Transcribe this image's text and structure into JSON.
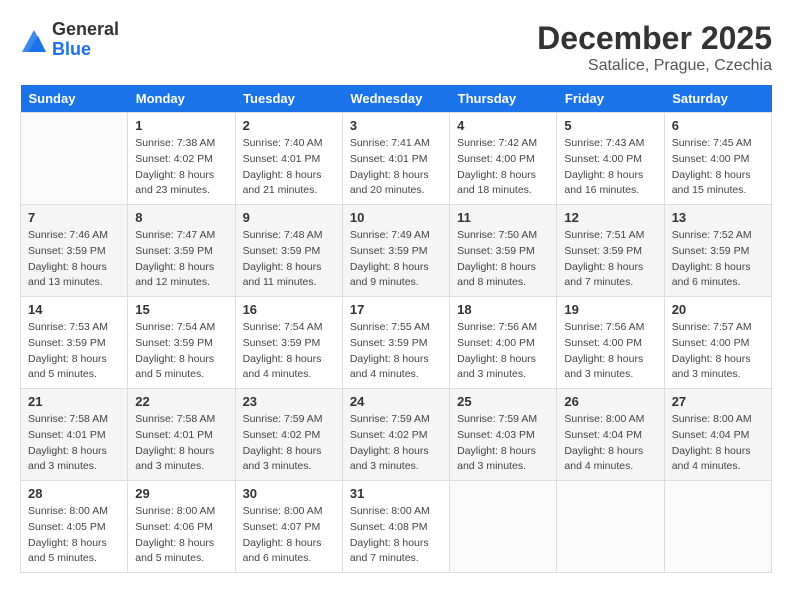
{
  "header": {
    "logo": {
      "general": "General",
      "blue": "Blue"
    },
    "title": "December 2025",
    "subtitle": "Satalice, Prague, Czechia"
  },
  "days_of_week": [
    "Sunday",
    "Monday",
    "Tuesday",
    "Wednesday",
    "Thursday",
    "Friday",
    "Saturday"
  ],
  "weeks": [
    [
      {
        "num": "",
        "info": ""
      },
      {
        "num": "1",
        "info": "Sunrise: 7:38 AM\nSunset: 4:02 PM\nDaylight: 8 hours\nand 23 minutes."
      },
      {
        "num": "2",
        "info": "Sunrise: 7:40 AM\nSunset: 4:01 PM\nDaylight: 8 hours\nand 21 minutes."
      },
      {
        "num": "3",
        "info": "Sunrise: 7:41 AM\nSunset: 4:01 PM\nDaylight: 8 hours\nand 20 minutes."
      },
      {
        "num": "4",
        "info": "Sunrise: 7:42 AM\nSunset: 4:00 PM\nDaylight: 8 hours\nand 18 minutes."
      },
      {
        "num": "5",
        "info": "Sunrise: 7:43 AM\nSunset: 4:00 PM\nDaylight: 8 hours\nand 16 minutes."
      },
      {
        "num": "6",
        "info": "Sunrise: 7:45 AM\nSunset: 4:00 PM\nDaylight: 8 hours\nand 15 minutes."
      }
    ],
    [
      {
        "num": "7",
        "info": "Sunrise: 7:46 AM\nSunset: 3:59 PM\nDaylight: 8 hours\nand 13 minutes."
      },
      {
        "num": "8",
        "info": "Sunrise: 7:47 AM\nSunset: 3:59 PM\nDaylight: 8 hours\nand 12 minutes."
      },
      {
        "num": "9",
        "info": "Sunrise: 7:48 AM\nSunset: 3:59 PM\nDaylight: 8 hours\nand 11 minutes."
      },
      {
        "num": "10",
        "info": "Sunrise: 7:49 AM\nSunset: 3:59 PM\nDaylight: 8 hours\nand 9 minutes."
      },
      {
        "num": "11",
        "info": "Sunrise: 7:50 AM\nSunset: 3:59 PM\nDaylight: 8 hours\nand 8 minutes."
      },
      {
        "num": "12",
        "info": "Sunrise: 7:51 AM\nSunset: 3:59 PM\nDaylight: 8 hours\nand 7 minutes."
      },
      {
        "num": "13",
        "info": "Sunrise: 7:52 AM\nSunset: 3:59 PM\nDaylight: 8 hours\nand 6 minutes."
      }
    ],
    [
      {
        "num": "14",
        "info": "Sunrise: 7:53 AM\nSunset: 3:59 PM\nDaylight: 8 hours\nand 5 minutes."
      },
      {
        "num": "15",
        "info": "Sunrise: 7:54 AM\nSunset: 3:59 PM\nDaylight: 8 hours\nand 5 minutes."
      },
      {
        "num": "16",
        "info": "Sunrise: 7:54 AM\nSunset: 3:59 PM\nDaylight: 8 hours\nand 4 minutes."
      },
      {
        "num": "17",
        "info": "Sunrise: 7:55 AM\nSunset: 3:59 PM\nDaylight: 8 hours\nand 4 minutes."
      },
      {
        "num": "18",
        "info": "Sunrise: 7:56 AM\nSunset: 4:00 PM\nDaylight: 8 hours\nand 3 minutes."
      },
      {
        "num": "19",
        "info": "Sunrise: 7:56 AM\nSunset: 4:00 PM\nDaylight: 8 hours\nand 3 minutes."
      },
      {
        "num": "20",
        "info": "Sunrise: 7:57 AM\nSunset: 4:00 PM\nDaylight: 8 hours\nand 3 minutes."
      }
    ],
    [
      {
        "num": "21",
        "info": "Sunrise: 7:58 AM\nSunset: 4:01 PM\nDaylight: 8 hours\nand 3 minutes."
      },
      {
        "num": "22",
        "info": "Sunrise: 7:58 AM\nSunset: 4:01 PM\nDaylight: 8 hours\nand 3 minutes."
      },
      {
        "num": "23",
        "info": "Sunrise: 7:59 AM\nSunset: 4:02 PM\nDaylight: 8 hours\nand 3 minutes."
      },
      {
        "num": "24",
        "info": "Sunrise: 7:59 AM\nSunset: 4:02 PM\nDaylight: 8 hours\nand 3 minutes."
      },
      {
        "num": "25",
        "info": "Sunrise: 7:59 AM\nSunset: 4:03 PM\nDaylight: 8 hours\nand 3 minutes."
      },
      {
        "num": "26",
        "info": "Sunrise: 8:00 AM\nSunset: 4:04 PM\nDaylight: 8 hours\nand 4 minutes."
      },
      {
        "num": "27",
        "info": "Sunrise: 8:00 AM\nSunset: 4:04 PM\nDaylight: 8 hours\nand 4 minutes."
      }
    ],
    [
      {
        "num": "28",
        "info": "Sunrise: 8:00 AM\nSunset: 4:05 PM\nDaylight: 8 hours\nand 5 minutes."
      },
      {
        "num": "29",
        "info": "Sunrise: 8:00 AM\nSunset: 4:06 PM\nDaylight: 8 hours\nand 5 minutes."
      },
      {
        "num": "30",
        "info": "Sunrise: 8:00 AM\nSunset: 4:07 PM\nDaylight: 8 hours\nand 6 minutes."
      },
      {
        "num": "31",
        "info": "Sunrise: 8:00 AM\nSunset: 4:08 PM\nDaylight: 8 hours\nand 7 minutes."
      },
      {
        "num": "",
        "info": ""
      },
      {
        "num": "",
        "info": ""
      },
      {
        "num": "",
        "info": ""
      }
    ]
  ]
}
